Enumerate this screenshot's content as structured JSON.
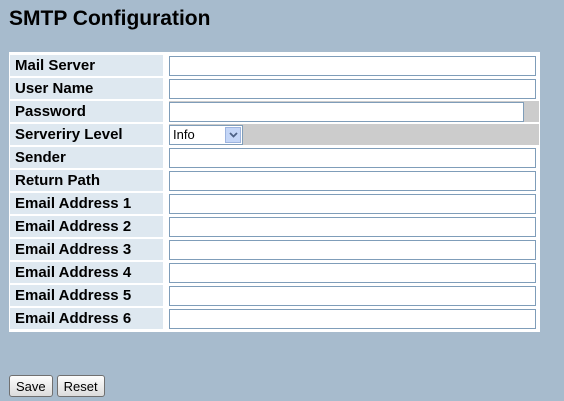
{
  "page_title": "SMTP Configuration",
  "fields": {
    "mail_server": {
      "label": "Mail Server",
      "value": ""
    },
    "user_name": {
      "label": "User Name",
      "value": ""
    },
    "password": {
      "label": "Password",
      "value": ""
    },
    "severity_level": {
      "label": "Serveriry Level",
      "selected": "Info"
    },
    "sender": {
      "label": "Sender",
      "value": ""
    },
    "return_path": {
      "label": "Return Path",
      "value": ""
    },
    "email_1": {
      "label": "Email Address 1",
      "value": ""
    },
    "email_2": {
      "label": "Email Address 2",
      "value": ""
    },
    "email_3": {
      "label": "Email Address 3",
      "value": ""
    },
    "email_4": {
      "label": "Email Address 4",
      "value": ""
    },
    "email_5": {
      "label": "Email Address 5",
      "value": ""
    },
    "email_6": {
      "label": "Email Address 6",
      "value": ""
    }
  },
  "buttons": {
    "save": "Save",
    "reset": "Reset"
  },
  "colors": {
    "background": "#a7bbcd",
    "label_cell": "#dee8f0",
    "shaded_cell": "#cccccc"
  }
}
